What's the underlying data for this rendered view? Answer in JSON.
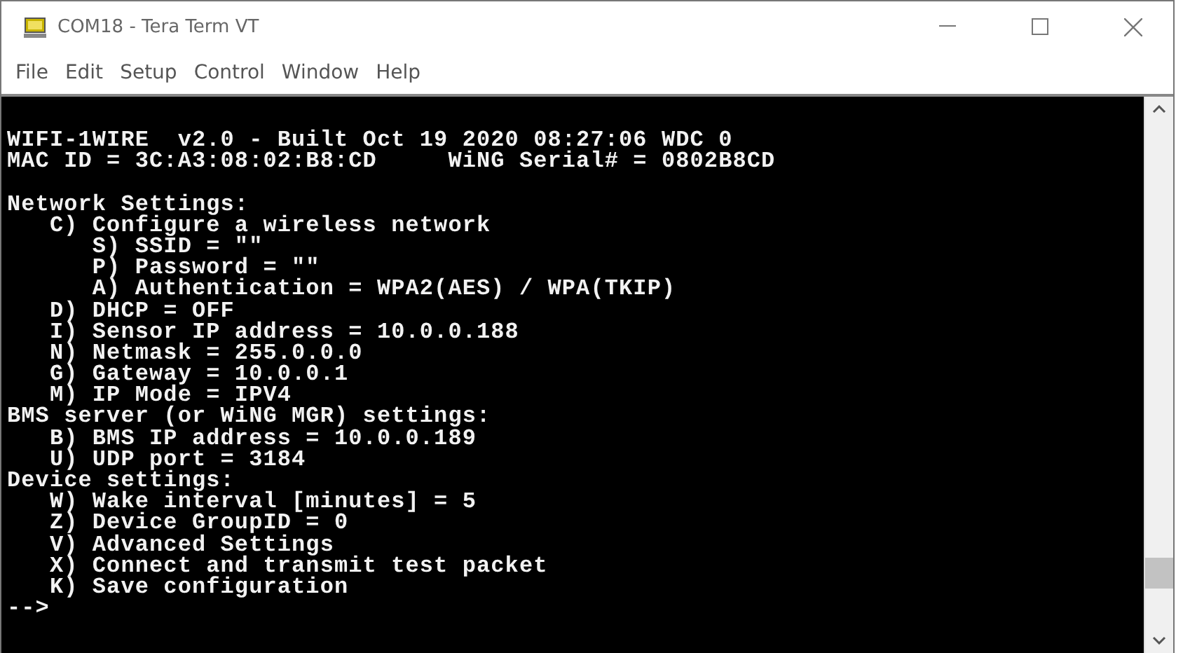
{
  "window": {
    "title": "COM18 - Tera Term VT"
  },
  "menu": [
    "File",
    "Edit",
    "Setup",
    "Control",
    "Window",
    "Help"
  ],
  "terminal": {
    "blocks": [
      [
        "WIFI-1WIRE  v2.0 - Built Oct 19 2020 08:27:06 WDC 0",
        "MAC ID = 3C:A3:08:02:B8:CD     WiNG Serial# = 0802B8CD"
      ],
      [
        "Network Settings:",
        "   C) Configure a wireless network",
        "      S) SSID = \"\"",
        "      P) Password = \"\"",
        "      A) Authentication = WPA2(AES) / WPA(TKIP)",
        "   D) DHCP = OFF",
        "   I) Sensor IP address = 10.0.0.188",
        "   N) Netmask = 255.0.0.0",
        "   G) Gateway = 10.0.0.1",
        "   M) IP Mode = IPV4",
        "BMS server (or WiNG MGR) settings:",
        "   B) BMS IP address = 10.0.0.189",
        "   U) UDP port = 3184",
        "Device settings:",
        "   W) Wake interval [minutes] = 5",
        "   Z) Device GroupID = 0",
        "   V) Advanced Settings",
        "   X) Connect and transmit test packet",
        "   K) Save configuration",
        "-->"
      ]
    ]
  }
}
